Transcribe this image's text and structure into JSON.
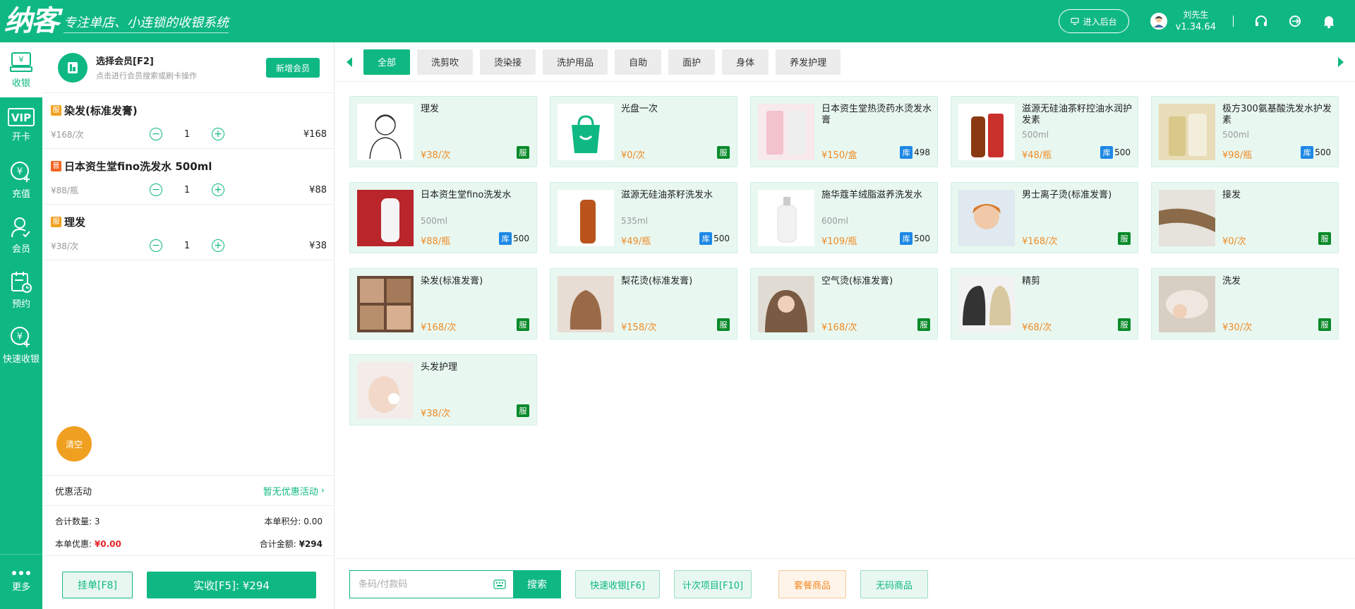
{
  "header": {
    "logo": "纳客",
    "slogan": "专注单店、小连锁的收银系统",
    "backend_label": "进入后台",
    "user_name": "刘先生",
    "version": "v1.34.64"
  },
  "nav": {
    "items": [
      {
        "label": "收银",
        "icon": "cashier-icon"
      },
      {
        "label": "开卡",
        "icon": "vip-card-icon"
      },
      {
        "label": "充值",
        "icon": "recharge-icon"
      },
      {
        "label": "会员",
        "icon": "member-icon"
      },
      {
        "label": "预约",
        "icon": "calendar-icon"
      },
      {
        "label": "快速收银",
        "icon": "quick-cash-icon"
      }
    ],
    "more_label": "更多"
  },
  "member": {
    "title": "选择会员[F2]",
    "hint": "点击进行会员搜索或刷卡操作",
    "new_button": "新增会员"
  },
  "cart": {
    "items": [
      {
        "tag": "服",
        "name": "染发(标准发膏)",
        "price": "¥168/次",
        "qty": "1",
        "total": "¥168"
      },
      {
        "tag": "普",
        "name": "日本资生堂fino洗发水 500ml",
        "price": "¥88/瓶",
        "qty": "1",
        "total": "¥88"
      },
      {
        "tag": "服",
        "name": "理发",
        "price": "¥38/次",
        "qty": "1",
        "total": "¥38"
      }
    ],
    "clear_label": "清空",
    "promo_label": "优惠活动",
    "promo_value": "暂无优惠活动",
    "count_label": "合计数量:",
    "count_value": "3",
    "points_label": "本单积分:",
    "points_value": "0.00",
    "discount_label": "本单优惠:",
    "discount_value": "¥0.00",
    "total_label": "合计金额:",
    "total_value": "¥294",
    "hang_label": "挂单[F8]",
    "pay_label": "实收[F5]: ¥294"
  },
  "categories": [
    "全部",
    "洗剪吹",
    "烫染接",
    "洗护用品",
    "自助",
    "面护",
    "身体",
    "养发护理"
  ],
  "products": [
    {
      "name": "理发",
      "spec": "",
      "price": "¥38/次",
      "badge": "服",
      "stock": ""
    },
    {
      "name": "光盘一次",
      "spec": "",
      "price": "¥0/次",
      "badge": "服",
      "stock": ""
    },
    {
      "name": "日本资生堂热烫药水烫发水膏",
      "spec": "",
      "price": "¥150/盒",
      "badge": "库",
      "stock": "498"
    },
    {
      "name": "滋源无硅油茶籽控油水润护发素",
      "spec": "500ml",
      "price": "¥48/瓶",
      "badge": "库",
      "stock": "500"
    },
    {
      "name": "极方300氨基酸洗发水护发素",
      "spec": "500ml",
      "price": "¥98/瓶",
      "badge": "库",
      "stock": "500"
    },
    {
      "name": "日本资生堂fino洗发水",
      "spec": "500ml",
      "price": "¥88/瓶",
      "badge": "库",
      "stock": "500"
    },
    {
      "name": "滋源无硅油茶籽洗发水",
      "spec": "535ml",
      "price": "¥49/瓶",
      "badge": "库",
      "stock": "500"
    },
    {
      "name": "施华蔻羊绒脂滋养洗发水",
      "spec": "600ml",
      "price": "¥109/瓶",
      "badge": "库",
      "stock": "500"
    },
    {
      "name": "男士离子烫(标准发膏)",
      "spec": "",
      "price": "¥168/次",
      "badge": "服",
      "stock": ""
    },
    {
      "name": "接发",
      "spec": "",
      "price": "¥0/次",
      "badge": "服",
      "stock": ""
    },
    {
      "name": "染发(标准发膏)",
      "spec": "",
      "price": "¥168/次",
      "badge": "服",
      "stock": ""
    },
    {
      "name": "梨花烫(标准发膏)",
      "spec": "",
      "price": "¥158/次",
      "badge": "服",
      "stock": ""
    },
    {
      "name": "空气烫(标准发膏)",
      "spec": "",
      "price": "¥168/次",
      "badge": "服",
      "stock": ""
    },
    {
      "name": "精剪",
      "spec": "",
      "price": "¥68/次",
      "badge": "服",
      "stock": ""
    },
    {
      "name": "洗发",
      "spec": "",
      "price": "¥30/次",
      "badge": "服",
      "stock": ""
    },
    {
      "name": "头发护理",
      "spec": "",
      "price": "¥38/次",
      "badge": "服",
      "stock": ""
    }
  ],
  "toolbar": {
    "search_placeholder": "条码/付款码",
    "search_label": "搜索",
    "quick_cash": "快速收银[F6]",
    "count_item": "计次项目[F10]",
    "package": "套餐商品",
    "no_code": "无码商品"
  },
  "colors": {
    "primary": "#0fb882",
    "orange": "#f08a24",
    "red": "#e5272b",
    "service_badge": "#0a8a2a",
    "stock_badge": "#1e88e5"
  }
}
